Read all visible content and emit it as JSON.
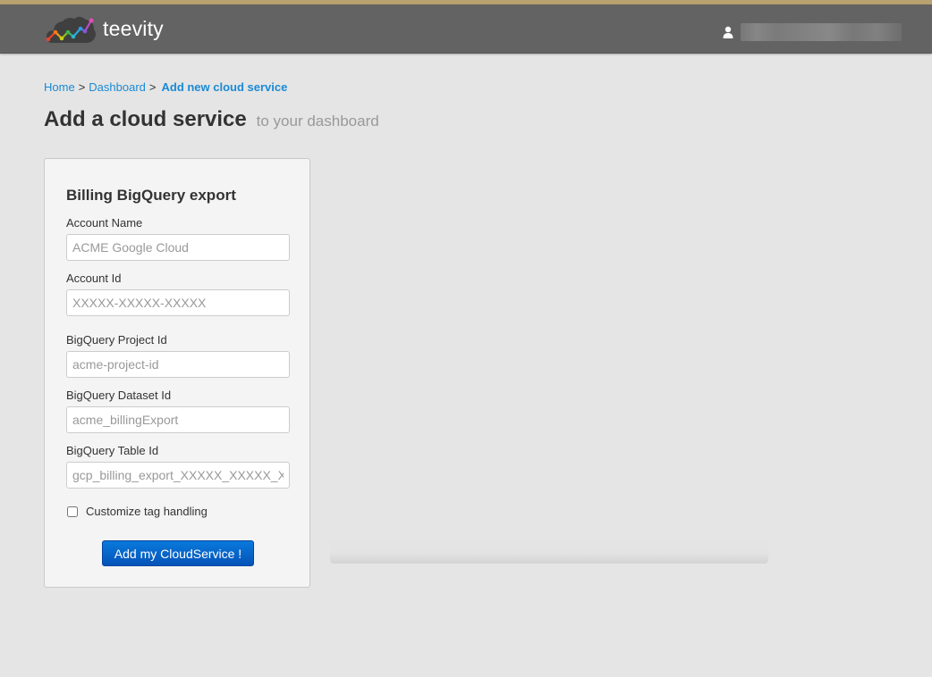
{
  "navbar": {
    "brand": "teevity",
    "logo_icon": "cloud-rainbow-chart-icon",
    "user_icon": "user-icon",
    "user_name": "[redacted]"
  },
  "breadcrumb": {
    "items": [
      {
        "label": "Home"
      },
      {
        "label": "Dashboard"
      }
    ],
    "separator": ">",
    "current": "Add new cloud service"
  },
  "page": {
    "title": "Add a cloud service",
    "subtitle": "to your dashboard"
  },
  "form": {
    "title": "Billing BigQuery export",
    "fields": [
      {
        "label": "Account Name",
        "value": "",
        "placeholder": "ACME Google Cloud"
      },
      {
        "label": "Account Id",
        "value": "",
        "placeholder": "XXXXX-XXXXX-XXXXX"
      },
      {
        "label": "BigQuery Project Id",
        "value": "",
        "placeholder": "acme-project-id"
      },
      {
        "label": "BigQuery Dataset Id",
        "value": "",
        "placeholder": "acme_billingExport"
      },
      {
        "label": "BigQuery Table Id",
        "value": "",
        "placeholder": "gcp_billing_export_XXXXX_XXXXX_XXXXX"
      }
    ],
    "checkbox": {
      "label": "Customize tag handling",
      "checked": false
    },
    "submit_label": "Add my CloudService !"
  },
  "progress": {
    "value_percent": 0
  },
  "colors": {
    "accent": "#1a8ad5",
    "button": "#0a79dc",
    "navbar": "#636363",
    "top_stripe": "#b9a270"
  }
}
